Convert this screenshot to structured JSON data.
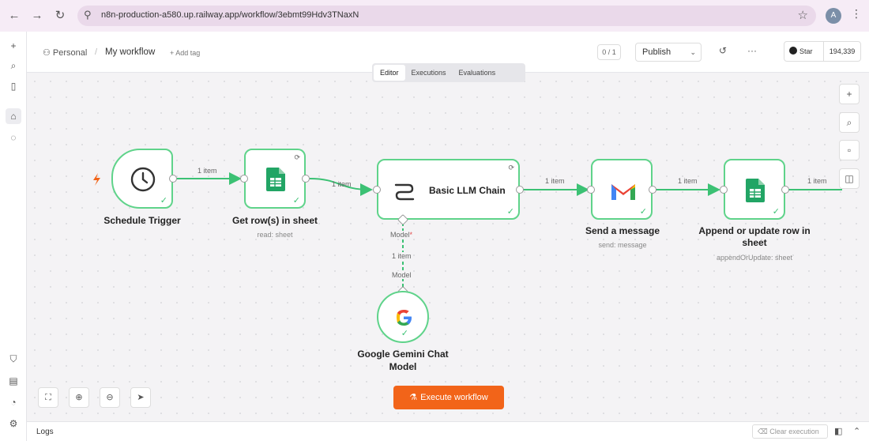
{
  "browser": {
    "url": "n8n-production-a580.up.railway.app/workflow/3ebmt99Hdv3TNaxN",
    "avatar_letter": "A"
  },
  "header": {
    "breadcrumb_personal": "Personal",
    "workflow_name": "My workflow",
    "add_tag": "+ Add tag",
    "counter": "0 / 1",
    "publish_label": "Publish",
    "github_star": "Star",
    "github_count": "194,339"
  },
  "tabs": [
    {
      "label": "Editor",
      "active": true
    },
    {
      "label": "Executions",
      "active": false
    },
    {
      "label": "Evaluations",
      "active": false
    }
  ],
  "nodes": {
    "schedule": {
      "label": "Schedule Trigger",
      "icon": "clock-icon"
    },
    "get_rows": {
      "label": "Get row(s) in sheet",
      "sub": "read: sheet",
      "icon": "google-sheets-icon"
    },
    "llm_chain": {
      "label": "Basic LLM Chain",
      "icon": "chain-icon"
    },
    "send_message": {
      "label": "Send a message",
      "sub": "send: message",
      "icon": "gmail-icon"
    },
    "append_row": {
      "label": "Append or update row in sheet",
      "sub": "appendOrUpdate: sheet",
      "icon": "google-sheets-icon"
    },
    "gemini": {
      "label": "Google Gemini Chat Model",
      "icon": "google-icon"
    }
  },
  "edges": {
    "e1": "1 item",
    "e2": "1 item",
    "e3": "1 item",
    "e4": "1 item",
    "e5": "1 item",
    "model_top": "Model",
    "model_required": "*",
    "model_item": "1 item",
    "model_bottom": "Model"
  },
  "canvas": {
    "execute_label": "Execute workflow"
  },
  "footer": {
    "logs_label": "Logs",
    "clear_execution": "Clear execution"
  },
  "colors": {
    "node_border": "#5fd38a",
    "edge": "#3cc174",
    "execute": "#f26419",
    "sheets_green": "#22a565"
  }
}
